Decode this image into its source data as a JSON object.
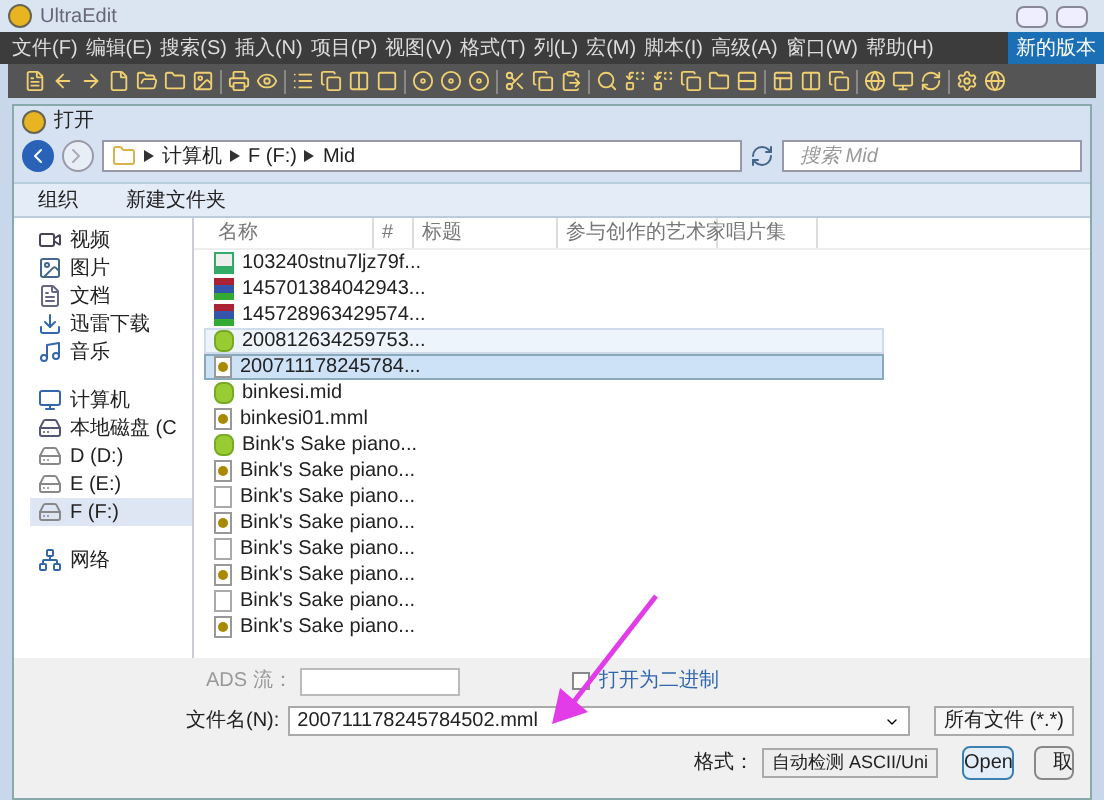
{
  "window": {
    "title": "UltraEdit"
  },
  "menu": [
    "文件(F)",
    "编辑(E)",
    "搜索(S)",
    "插入(N)",
    "项目(P)",
    "视图(V)",
    "格式(T)",
    "列(L)",
    "宏(M)",
    "脚本(I)",
    "高级(A)",
    "窗口(W)",
    "帮助(H)"
  ],
  "new_version": "新的版本",
  "dialog": {
    "title": "打开",
    "breadcrumb": [
      "计算机",
      "F (F:)",
      "Mid"
    ],
    "search": {
      "placeholder": "搜索 Mid"
    },
    "toolbar": {
      "organize": "组织",
      "new_folder": "新建文件夹"
    },
    "nav": [
      {
        "label": "视频",
        "kind": "video",
        "selected": false
      },
      {
        "label": "图片",
        "kind": "image",
        "selected": false
      },
      {
        "label": "文档",
        "kind": "doc",
        "selected": false
      },
      {
        "label": "迅雷下载",
        "kind": "download",
        "selected": false
      },
      {
        "label": "音乐",
        "kind": "music",
        "selected": false
      },
      {
        "kind": "gap"
      },
      {
        "label": "计算机",
        "kind": "computer",
        "selected": false
      },
      {
        "label": "本地磁盘 (C",
        "kind": "disk",
        "selected": false
      },
      {
        "label": "D (D:)",
        "kind": "drive",
        "selected": false
      },
      {
        "label": "E (E:)",
        "kind": "drive",
        "selected": false
      },
      {
        "label": "F (F:)",
        "kind": "drive",
        "selected": true
      },
      {
        "kind": "gap"
      },
      {
        "label": "网络",
        "kind": "network",
        "selected": false
      }
    ],
    "columns": [
      "名称",
      "#",
      "标题",
      "参与创作的艺术家",
      "唱片集"
    ],
    "files": [
      {
        "name": "103240stnu7ljz79f...",
        "kind": "sm",
        "selected": false,
        "hover": false
      },
      {
        "name": "145701384042943...",
        "kind": "rar",
        "selected": false,
        "hover": false
      },
      {
        "name": "145728963429574...",
        "kind": "rar",
        "selected": false,
        "hover": false
      },
      {
        "name": "200812634259753...",
        "kind": "mid",
        "selected": false,
        "hover": true
      },
      {
        "name": "200711178245784...",
        "kind": "mml",
        "selected": true,
        "hover": false
      },
      {
        "name": "binkesi.mid",
        "kind": "mid",
        "selected": false,
        "hover": false
      },
      {
        "name": "binkesi01.mml",
        "kind": "mml",
        "selected": false,
        "hover": false
      },
      {
        "name": "Bink's Sake piano...",
        "kind": "mid",
        "selected": false,
        "hover": false
      },
      {
        "name": "Bink's Sake piano...",
        "kind": "mml",
        "selected": false,
        "hover": false
      },
      {
        "name": "Bink's Sake piano...",
        "kind": "blank",
        "selected": false,
        "hover": false
      },
      {
        "name": "Bink's Sake piano...",
        "kind": "mml",
        "selected": false,
        "hover": false
      },
      {
        "name": "Bink's Sake piano...",
        "kind": "blank",
        "selected": false,
        "hover": false
      },
      {
        "name": "Bink's Sake piano...",
        "kind": "mml",
        "selected": false,
        "hover": false
      },
      {
        "name": "Bink's Sake piano...",
        "kind": "blank",
        "selected": false,
        "hover": false
      },
      {
        "name": "Bink's Sake piano...",
        "kind": "mml",
        "selected": false,
        "hover": false
      }
    ],
    "ads_label": "ADS 流：",
    "binary": {
      "label": "打开为二进制",
      "checked": false
    },
    "filename_label": "文件名(N):",
    "filename": "200711178245784502.mml",
    "filetype": "所有文件 (*.*)",
    "format_label": "格式：",
    "format": "自动检测 ASCII/Uni",
    "open": "Open",
    "cancel": "取"
  }
}
